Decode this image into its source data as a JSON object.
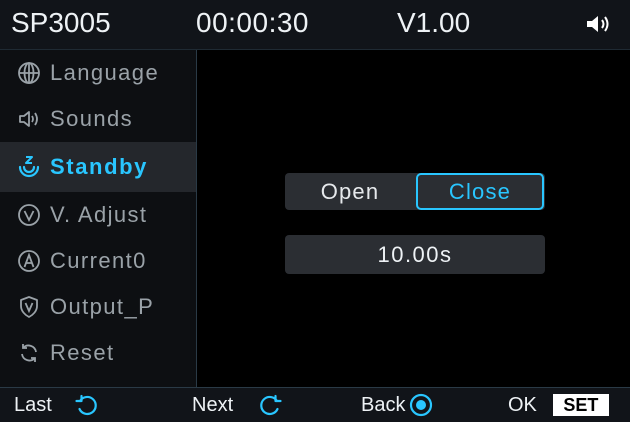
{
  "header": {
    "model": "SP3005",
    "time": "00:00:30",
    "version": "V1.00",
    "volume_icon": "speaker-volume-icon"
  },
  "menu": {
    "active": "Standby",
    "items": [
      {
        "label": "Language",
        "icon": "globe-icon"
      },
      {
        "label": "Sounds",
        "icon": "speaker-icon"
      },
      {
        "label": "Standby",
        "icon": "sleep-icon"
      },
      {
        "label": "V. Adjust",
        "icon": "v-circle-icon"
      },
      {
        "label": "Current0",
        "icon": "a-circle-icon"
      },
      {
        "label": "Output_P",
        "icon": "shield-v-icon"
      },
      {
        "label": "Reset",
        "icon": "refresh-icon"
      }
    ]
  },
  "standby": {
    "open_label": "Open",
    "close_label": "Close",
    "selected": "Close",
    "time_value": "10.00s"
  },
  "footer": {
    "last_label": "Last",
    "next_label": "Next",
    "back_label": "Back",
    "ok_label": "OK",
    "set_label": "SET"
  },
  "colors": {
    "accent": "#29c6ff",
    "menu_text": "#9aa2a8",
    "panel": "#2b2e33",
    "background": "#000000"
  }
}
